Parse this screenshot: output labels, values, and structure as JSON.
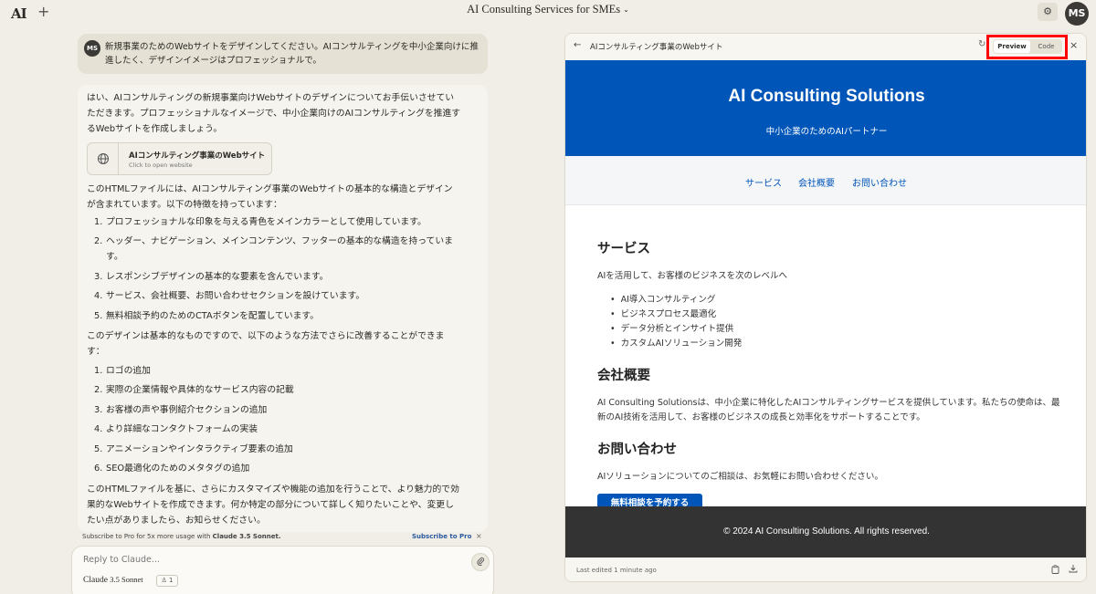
{
  "topbar": {
    "logo": "AI",
    "new_chat": "+",
    "title": "AI Consulting Services for SMEs",
    "title_chevron": "⌄",
    "settings_icon": "⚙",
    "avatar": "MS"
  },
  "user_message": {
    "avatar": "MS",
    "text": "新規事業のためのWebサイトをデザインしてください。AIコンサルティングを中小企業向けに推進したく、デザインイメージはプロフェッショナルで。"
  },
  "reply": {
    "intro": "はい、AIコンサルティングの新規事業向けWebサイトのデザインについてお手伝いさせていただきます。プロフェッショナルなイメージで、中小企業向けのAIコンサルティングを推進するWebサイトを作成しましょう。",
    "artifact_card": {
      "title": "AIコンサルティング事業のWebサイト",
      "subtitle": "Click to open website"
    },
    "features_intro": "このHTMLファイルには、AIコンサルティング事業のWebサイトの基本的な構造とデザインが含まれています。以下の特徴を持っています：",
    "features": [
      "プロフェッショナルな印象を与える青色をメインカラーとして使用しています。",
      "ヘッダー、ナビゲーション、メインコンテンツ、フッターの基本的な構造を持っています。",
      "レスポンシブデザインの基本的な要素を含んでいます。",
      "サービス、会社概要、お問い合わせセクションを設けています。",
      "無料相談予約のためのCTAボタンを配置しています。"
    ],
    "improvements_intro": "このデザインは基本的なものですので、以下のような方法でさらに改善することができます：",
    "improvements": [
      "ロゴの追加",
      "実際の企業情報や具体的なサービス内容の記載",
      "お客様の声や事例紹介セクションの追加",
      "より詳細なコンタクトフォームの実装",
      "アニメーションやインタラクティブ要素の追加",
      "SEO最適化のためのメタタグの追加"
    ],
    "closing": "このHTMLファイルを基に、さらにカスタマイズや機能の追加を行うことで、より魅力的で効果的なWebサイトを作成できます。何か特定の部分について詳しく知りたいことや、変更したい点がありましたら、お知らせください。"
  },
  "subscribe": {
    "text_prefix": "Subscribe to Pro for 5x more usage with ",
    "text_model": "Claude 3.5 Sonnet.",
    "link": "Subscribe to Pro",
    "close": "×"
  },
  "input": {
    "placeholder": "Reply to Claude...",
    "model_name": "Claude",
    "model_version": "3.5 Sonnet",
    "user_count": "1"
  },
  "panel": {
    "title": "AIコンサルティング事業のWebサイト",
    "toggle_preview": "Preview",
    "toggle_code": "Code",
    "close": "×",
    "last_edited": "Last edited 1 minute ago"
  },
  "site": {
    "hero_title": "AI Consulting Solutions",
    "hero_tagline": "中小企業のためのAIパートナー",
    "nav": [
      "サービス",
      "会社概要",
      "お問い合わせ"
    ],
    "services_heading": "サービス",
    "services_text": "AIを活用して、お客様のビジネスを次のレベルへ",
    "services_list": [
      "AI導入コンサルティング",
      "ビジネスプロセス最適化",
      "データ分析とインサイト提供",
      "カスタムAIソリューション開発"
    ],
    "about_heading": "会社概要",
    "about_text": "AI Consulting Solutionsは、中小企業に特化したAIコンサルティングサービスを提供しています。私たちの使命は、最新のAI技術を活用して、お客様のビジネスの成長と効率化をサポートすることです。",
    "contact_heading": "お問い合わせ",
    "contact_text": "AIソリューションについてのご相談は、お気軽にお問い合わせください。",
    "cta": "無料相談を予約する",
    "footer": "© 2024 AI Consulting Solutions. All rights reserved."
  },
  "colors": {
    "brand_blue": "#0055b8",
    "highlight": "#ff0000",
    "footer_bg": "#333333"
  }
}
